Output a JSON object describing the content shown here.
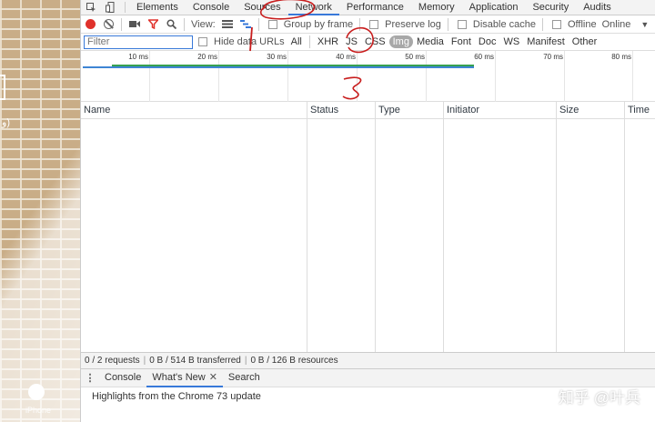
{
  "main_tabs": [
    "Elements",
    "Console",
    "Sources",
    "Network",
    "Performance",
    "Memory",
    "Application",
    "Security",
    "Audits"
  ],
  "toolbar": {
    "view_label": "View:",
    "group_by_frame": "Group by frame",
    "preserve_log": "Preserve log",
    "disable_cache": "Disable cache",
    "offline": "Offline",
    "throttle": "Online"
  },
  "filter": {
    "placeholder": "Filter",
    "hide_data_urls": "Hide data URLs",
    "types": [
      "All",
      "XHR",
      "JS",
      "CSS",
      "Img",
      "Media",
      "Font",
      "Doc",
      "WS",
      "Manifest",
      "Other"
    ],
    "selected": "Img"
  },
  "overview_ticks": [
    "10 ms",
    "20 ms",
    "30 ms",
    "40 ms",
    "50 ms",
    "60 ms",
    "70 ms",
    "80 ms"
  ],
  "columns": [
    "Name",
    "Status",
    "Type",
    "Initiator",
    "Size",
    "Time"
  ],
  "status": {
    "requests": "0 / 2 requests",
    "transferred": "0 B / 514 B transferred",
    "resources": "0 B / 126 B resources"
  },
  "drawer": {
    "tabs": [
      "Console",
      "What's New",
      "Search"
    ],
    "active": "What's New",
    "message": "Highlights from the Chrome 73 update"
  },
  "page_strip": {
    "glyph": "و)",
    "caption": "iPhone"
  },
  "watermark": "知乎 @叶兵",
  "colors": {
    "accent": "#3879d9",
    "record": "#e0312b",
    "annotation": "#c81d1d",
    "timeline_green": "#37a150",
    "timeline_blue": "#3e85d4"
  }
}
